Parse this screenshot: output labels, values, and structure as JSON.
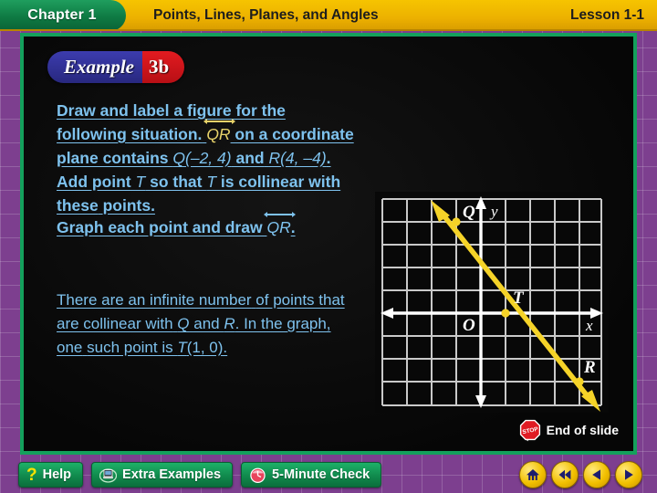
{
  "header": {
    "chapter": "Chapter 1",
    "title": "Points, Lines, Planes, and Angles",
    "lesson": "Lesson 1-1"
  },
  "example_badge": {
    "word": "Example",
    "number": "3b"
  },
  "content": {
    "para1_line1": "Draw and label a figure for the following situation.",
    "para1_qr": "QR",
    "para1_line2_rest": " on a coordinate plane contains ",
    "para1_q_point": "Q(–2, 4)",
    "para1_and": " and",
    "para1_r_point": "R(4, –4)",
    "para1_line3_rest": ". Add point ",
    "para1_t1": "T",
    "para1_line3_mid": " so that ",
    "para1_t2": "T",
    "para1_line3_end": " is collinear with these",
    "para1_line4": "points.",
    "para2_pre": "Graph each point and draw ",
    "para2_qr": "QR",
    "para2_post": ".",
    "para3_line1": "There are an infinite number",
    "para3_line2": "of points that are collinear with",
    "para3_line3_q": "Q",
    "para3_line3_and": " and ",
    "para3_line3_r": "R",
    "para3_line3_rest": ". In the graph, one",
    "para3_line4_pre": "such point is ",
    "para3_line4_t": "T",
    "para3_line4_coords": "(1, 0)."
  },
  "graph": {
    "x_axis_label": "x",
    "y_axis_label": "y",
    "origin_label": "O",
    "point_q_label": "Q",
    "point_t_label": "T",
    "point_r_label": "R",
    "line_color": "#f5d328",
    "grid_color": "#c8c8c8",
    "axis_color": "#ffffff"
  },
  "chart_data": {
    "type": "scatter",
    "title": "Coordinate plane with line QR and point T",
    "xlabel": "x",
    "ylabel": "y",
    "xlim": [
      -5,
      5
    ],
    "ylim": [
      -5,
      5
    ],
    "grid": true,
    "points": [
      {
        "label": "Q",
        "x": -2,
        "y": 4
      },
      {
        "label": "T",
        "x": 1,
        "y": 0
      },
      {
        "label": "R",
        "x": 4,
        "y": -4
      }
    ],
    "line": {
      "name": "QR",
      "through": [
        [
          -2,
          4
        ],
        [
          4,
          -4
        ]
      ],
      "slope": -1.3333,
      "intercept": 1.3333,
      "arrows": "both"
    }
  },
  "end_of_slide": {
    "label": "End of slide",
    "icon_text": "STOP"
  },
  "buttons": [
    {
      "name": "help",
      "label": "Help",
      "icon": "question-mark-icon"
    },
    {
      "name": "extra-examples",
      "label": "Extra Examples",
      "icon": "computer-icon"
    },
    {
      "name": "five-minute-check",
      "label": "5-Minute Check",
      "icon": "clock-icon"
    }
  ],
  "nav_buttons": [
    {
      "name": "home",
      "icon": "home-icon"
    },
    {
      "name": "rewind",
      "icon": "double-left-arrow-icon"
    },
    {
      "name": "previous",
      "icon": "left-arrow-icon"
    },
    {
      "name": "next",
      "icon": "right-arrow-icon"
    }
  ]
}
